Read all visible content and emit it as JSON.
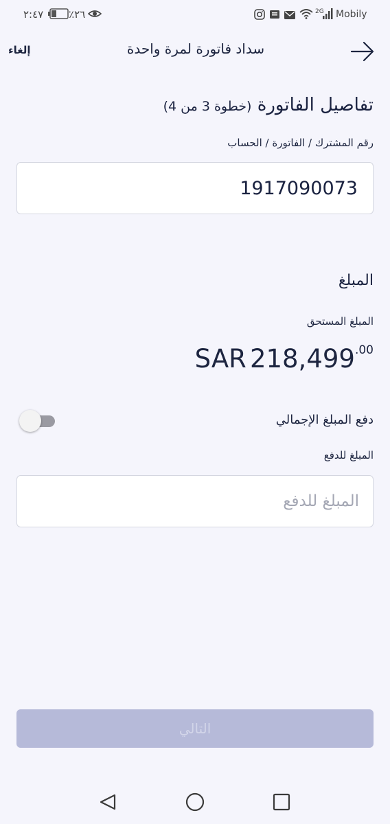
{
  "status_bar": {
    "time": "٢:٤٧",
    "battery": "٪٢٦",
    "carrier": "Mobily",
    "network": "2G"
  },
  "header": {
    "cancel_label": "إلغاء",
    "title": "سداد فاتورة لمرة واحدة"
  },
  "bill_details": {
    "heading": "تفاصيل الفاتورة",
    "step": "(خطوة 3 من 4)",
    "account_label": "رقم المشترك / الفاتورة / الحساب",
    "account_value": "1917090073"
  },
  "amount": {
    "heading": "المبلغ",
    "due_label": "المبلغ المستحق",
    "currency": "SAR",
    "due_integer": "218,499",
    "due_decimal": ".00",
    "pay_total_label": "دفع المبلغ الإجمالي",
    "pay_total_enabled": false,
    "pay_amount_label": "المبلغ للدفع",
    "pay_amount_placeholder": "المبلغ للدفع",
    "pay_amount_value": ""
  },
  "next_label": "التالي",
  "colors": {
    "background": "#f5f5fc",
    "text": "#1d2540",
    "button_disabled": "#b6bad9"
  }
}
